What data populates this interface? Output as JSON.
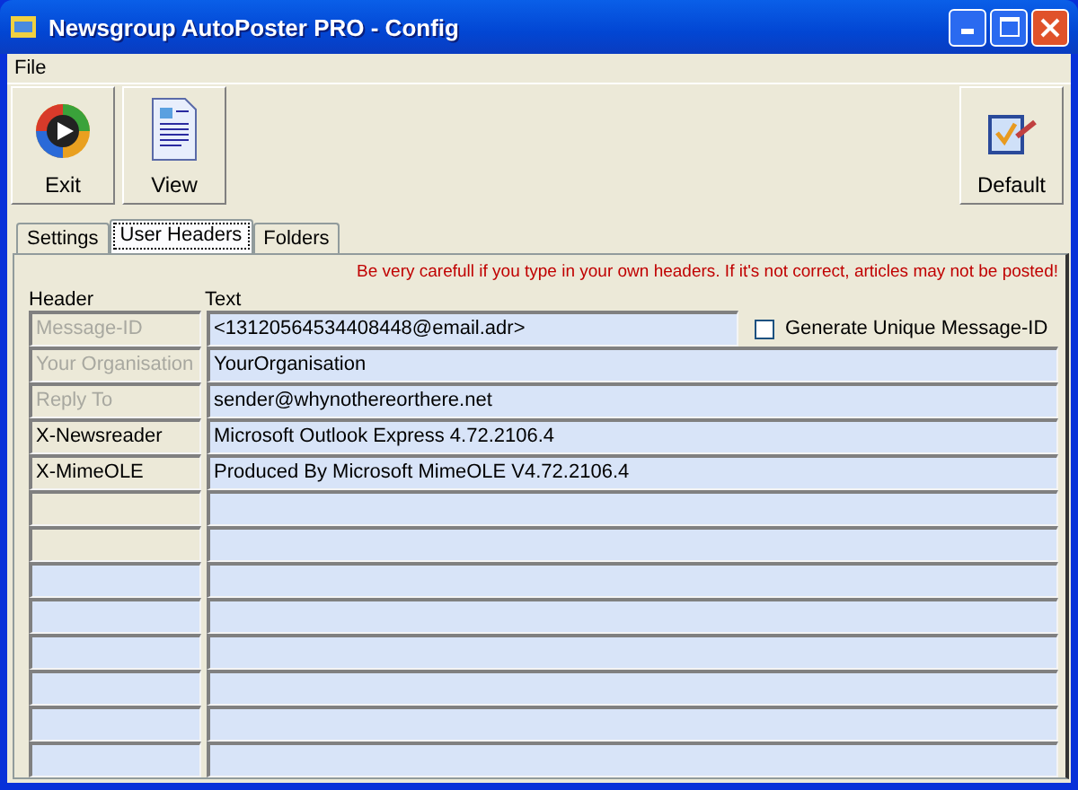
{
  "window": {
    "title": "Newsgroup AutoPoster PRO - Config"
  },
  "menu": [
    "File"
  ],
  "toolbar": [
    {
      "label": "Exit",
      "kind": "exit"
    },
    {
      "label": "View",
      "kind": "view"
    }
  ],
  "toolbar_right": [
    {
      "label": "Default",
      "kind": "default"
    }
  ],
  "tabs": [
    {
      "label": "Settings",
      "selected": false
    },
    {
      "label": "User Headers",
      "selected": true
    },
    {
      "label": "Folders",
      "selected": false
    }
  ],
  "warning": "Be very carefull if you type in your own headers. If it's not correct, articles may not be posted!",
  "columns": [
    "Header",
    "Text"
  ],
  "generate_unique": {
    "label": "Generate Unique Message-ID",
    "checked": false
  },
  "rows": [
    {
      "header": "Message-ID",
      "text": "<13120564534408448@email.adr>",
      "kind": "preset",
      "disabled": true
    },
    {
      "header": "Your Organisation",
      "text": "YourOrganisation",
      "kind": "preset",
      "disabled": true
    },
    {
      "header": "Reply To",
      "text": "sender@whynothereorthere.net",
      "kind": "preset",
      "disabled": true
    },
    {
      "header": "X-Newsreader",
      "text": "Microsoft Outlook Express 4.72.2106.4",
      "kind": "preset",
      "disabled": false
    },
    {
      "header": "X-MimeOLE",
      "text": "Produced By Microsoft MimeOLE V4.72.2106.4",
      "kind": "preset",
      "disabled": false
    },
    {
      "kind": "preset"
    },
    {
      "kind": "preset"
    },
    {
      "kind": "free"
    },
    {
      "kind": "free"
    },
    {
      "kind": "free"
    },
    {
      "kind": "free"
    },
    {
      "kind": "free"
    },
    {
      "kind": "free"
    }
  ]
}
